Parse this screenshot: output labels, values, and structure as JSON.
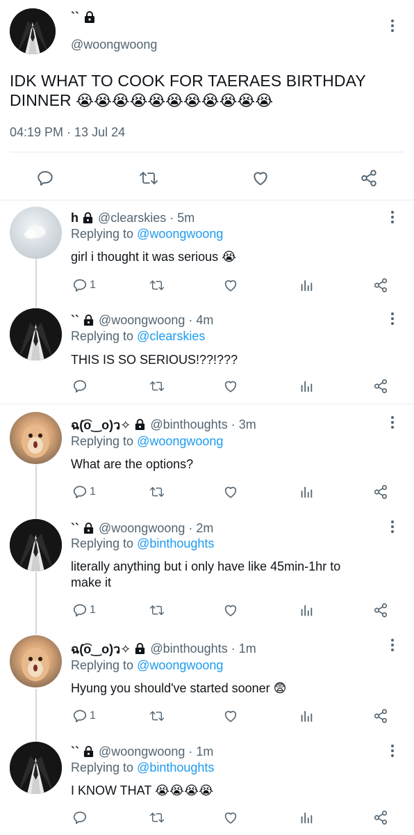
{
  "main_tweet": {
    "name": "``",
    "handle": "@woongwoong",
    "text": "IDK WHAT TO COOK FOR TAERAES BIRTHDAY DINNER",
    "text_line1": "IDK WHAT TO COOK FOR TAERAES BIRTHDAY",
    "text_line2": "DINNER",
    "emojis": "😭😭😭😭😭😭😭😭😭😭😭",
    "timestamp": "04:19 PM · 13 Jul 24"
  },
  "replies": [
    {
      "name": "h",
      "handle": "@clearskies · 5m",
      "replying_to_label": "Replying to",
      "replying_to": "@woongwoong",
      "text": "girl i thought it was serious 😭",
      "reply_count": "1"
    },
    {
      "name": "``",
      "handle": "@woongwoong · 4m",
      "replying_to_label": "Replying to",
      "replying_to": "@clearskies",
      "text": "THIS IS SO SERIOUS!??!???",
      "reply_count": ""
    },
    {
      "name": "ฉ(͡o‿o)ว✧",
      "handle": "@binthoughts · 3m",
      "replying_to_label": "Replying to",
      "replying_to": "@woongwoong",
      "text": "What are the options?",
      "reply_count": "1"
    },
    {
      "name": "``",
      "handle": "@woongwoong · 2m",
      "replying_to_label": "Replying to",
      "replying_to": "@binthoughts",
      "text_line1": "literally anything but i only have like 45min-1hr to",
      "text_line2": "make it",
      "reply_count": "1"
    },
    {
      "name": "ฉ(͡o‿o)ว✧",
      "handle": "@binthoughts · 1m",
      "replying_to_label": "Replying to",
      "replying_to": "@woongwoong",
      "text": "Hyung you should've started sooner 😨",
      "reply_count": "1"
    },
    {
      "name": "``",
      "handle": "@woongwoong · 1m",
      "replying_to_label": "Replying to",
      "replying_to": "@binthoughts",
      "text": "I KNOW THAT 😭😭😭😭",
      "reply_count": ""
    }
  ],
  "icons": {
    "lock": "lock-icon",
    "more": "more-icon",
    "reply": "reply-icon",
    "retweet": "retweet-icon",
    "like": "heart-icon",
    "views": "views-icon",
    "share": "share-icon"
  },
  "colors": {
    "link": "#1d9bf0",
    "muted": "#536471",
    "text": "#0f1419",
    "separator": "#e6e9ea"
  }
}
